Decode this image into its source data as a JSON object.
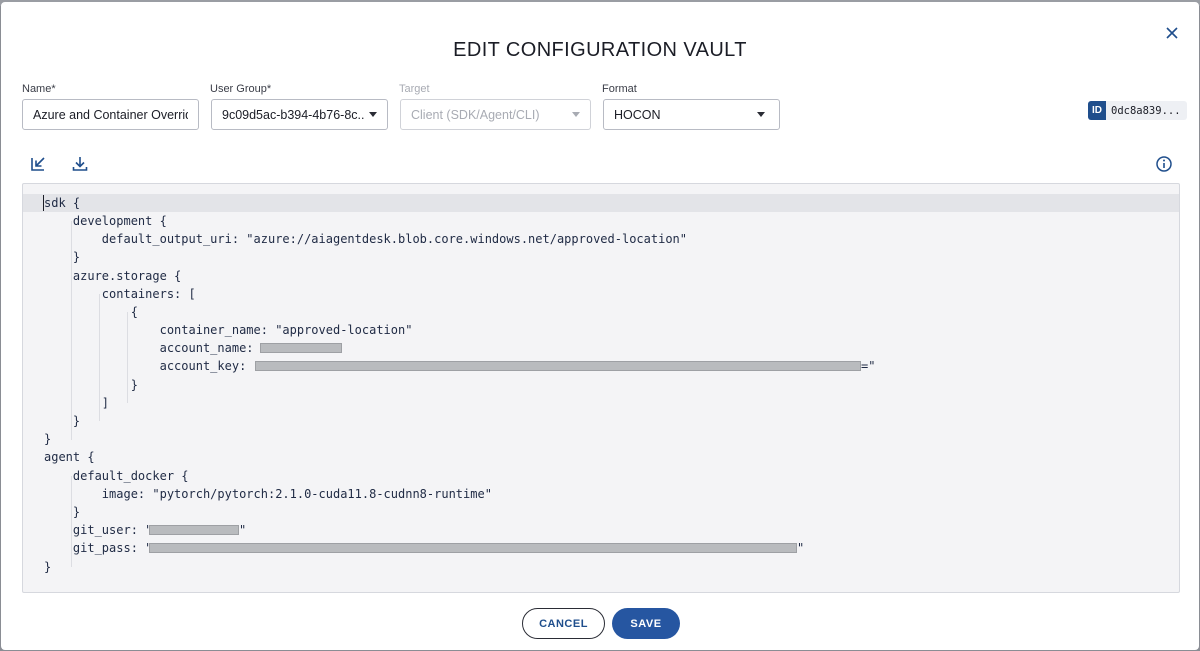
{
  "dialog": {
    "title": "EDIT CONFIGURATION VAULT",
    "close_icon": "close-icon"
  },
  "form": {
    "name": {
      "label": "Name*",
      "value": "Azure and Container Overrides"
    },
    "user_group": {
      "label": "User Group*",
      "value": "9c09d5ac-b394-4b76-8c..."
    },
    "target": {
      "label": "Target",
      "value": "Client (SDK/Agent/CLI)",
      "disabled": true
    },
    "format": {
      "label": "Format",
      "value": "HOCON"
    }
  },
  "id_badge": {
    "tag": "ID",
    "value": "0dc8a839..."
  },
  "toolbar": {
    "import_icon": "import-icon",
    "download_icon": "download-icon",
    "info_icon": "info-icon"
  },
  "editor": {
    "lines": [
      "sdk {",
      "    development {",
      "        default_output_uri: \"azure://aiagentdesk.blob.core.windows.net/approved-location\"",
      "    }",
      "    azure.storage {",
      "        containers: [",
      "            {",
      "                container_name: \"approved-location\"",
      "                account_name: \"",
      "                account_key: \"",
      "            }",
      "        ]",
      "    }",
      "}",
      "agent {",
      "    default_docker {",
      "        image: \"pytorch/pytorch:2.1.0-cuda11.8-cudnn8-runtime\"",
      "    }",
      "    git_user: \"",
      "    git_pass: \"",
      "}"
    ],
    "redacted_suffix_account_key": "=\"",
    "redacted_suffix_git": "\""
  },
  "actions": {
    "cancel_label": "CANCEL",
    "save_label": "SAVE"
  },
  "colors": {
    "accent": "#2656a1",
    "id_tag": "#1f4e8c",
    "editor_bg": "#f4f4f6"
  }
}
